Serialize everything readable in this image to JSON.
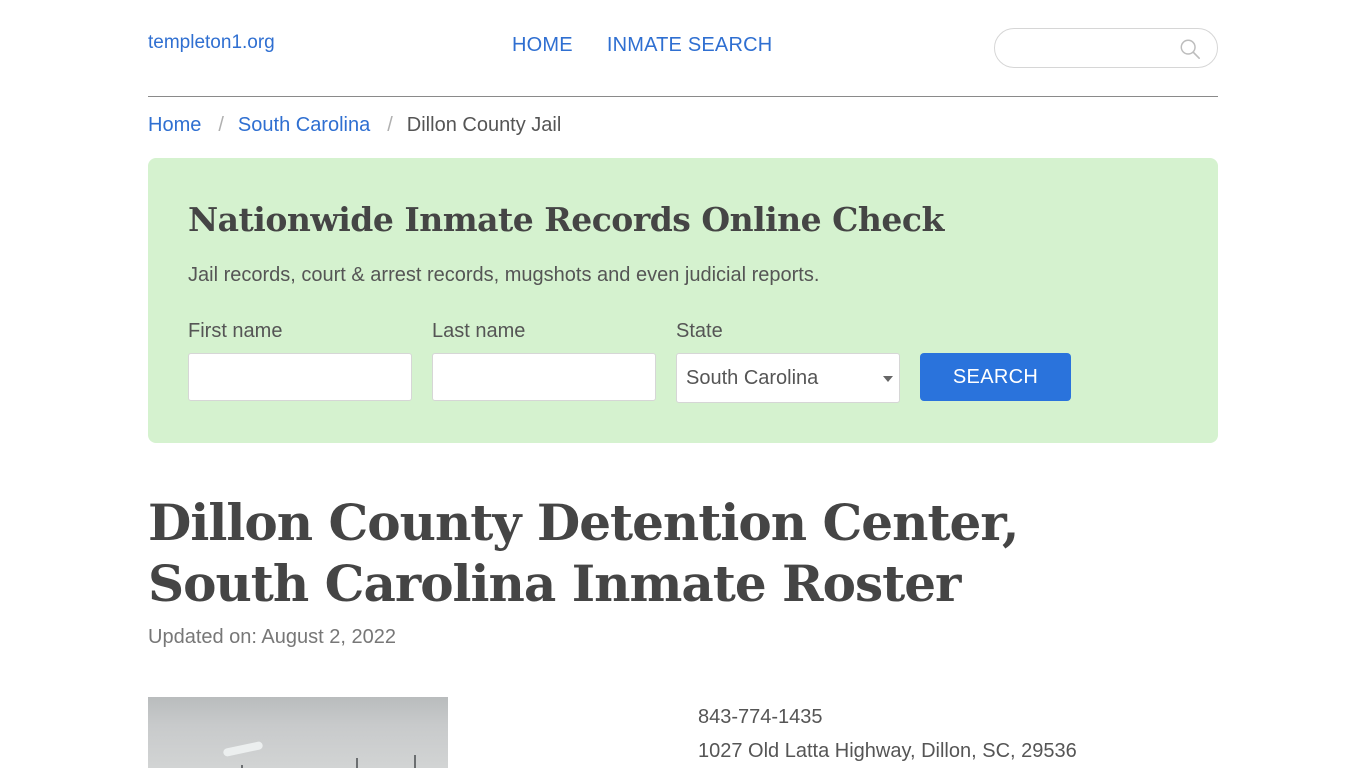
{
  "header": {
    "logo": "templeton1.org",
    "nav": [
      {
        "label": "HOME"
      },
      {
        "label": "INMATE SEARCH"
      }
    ],
    "search": {
      "placeholder": "",
      "value": "",
      "icon": "search-icon"
    }
  },
  "breadcrumb": {
    "items": [
      {
        "label": "Home"
      },
      {
        "label": "South Carolina"
      }
    ],
    "separator": "/",
    "current": "Dillon County Jail"
  },
  "promo": {
    "title": "Nationwide Inmate Records Online Check",
    "subtitle": "Jail records, court & arrest records, mugshots and even judicial reports.",
    "first_name_label": "First name",
    "first_name_value": "",
    "last_name_label": "Last name",
    "last_name_value": "",
    "state_label": "State",
    "state_selected": "South Carolina",
    "search_button": "SEARCH",
    "background_color": "#d5f2cf",
    "button_color": "#2a73dc"
  },
  "main": {
    "title": "Dillon County Detention Center, South Carolina Inmate Roster",
    "updated": "Updated on: August 2, 2022",
    "phone": "843-774-1435",
    "address": "1027 Old Latta Highway, Dillon, SC, 29536",
    "photo_alt": "facility-photo"
  },
  "colors": {
    "link": "#2f6fd1",
    "heading": "#454545",
    "text": "#555555"
  }
}
